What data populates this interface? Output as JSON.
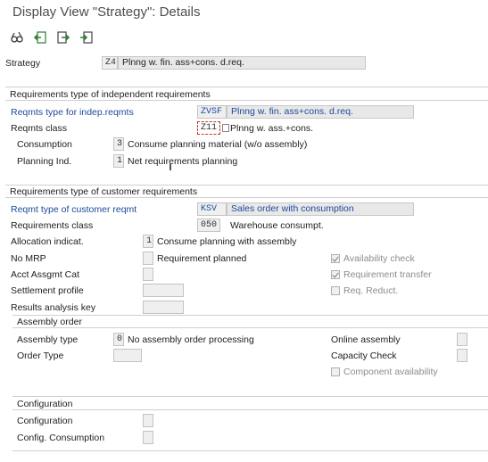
{
  "title": "Display View \"Strategy\": Details",
  "toolbar": [
    {
      "icon": "glasses-icon"
    },
    {
      "icon": "back-arrow-icon"
    },
    {
      "icon": "forward-arrow-icon"
    },
    {
      "icon": "export-icon"
    }
  ],
  "strategy": {
    "label": "Strategy",
    "code": "Z4",
    "desc": "Plnng w. fin. ass+cons. d.req."
  },
  "indep": {
    "title": "Requirements type of independent requirements",
    "reqmts_type": {
      "label": "Reqmts type for indep.reqmts",
      "code": "ZVSF",
      "desc": "Plnng w. fin. ass+cons. d.req."
    },
    "reqmts_class": {
      "label": "Reqmts class",
      "code": "Z11",
      "desc": "Plnng w. ass.+cons."
    },
    "consumption": {
      "label": "Consumption",
      "code": "3",
      "desc": "Consume planning material (w/o assembly)"
    },
    "planning_ind": {
      "label": "Planning Ind.",
      "code": "1",
      "desc": "Net requirements planning"
    }
  },
  "cust": {
    "title": "Requirements type of customer requirements",
    "reqmt_type": {
      "label": "Reqmt type of customer reqmt",
      "code": "KSV",
      "desc": "Sales order with consumption"
    },
    "req_class": {
      "label": "Requirements class",
      "code": "050",
      "desc": "Warehouse consumpt."
    },
    "allocation": {
      "label": "Allocation indicat.",
      "code": "1",
      "desc": "Consume planning with assembly"
    },
    "no_mrp": {
      "label": "No MRP",
      "code": "",
      "desc": "Requirement planned"
    },
    "acct": {
      "label": "Acct Assgmt Cat",
      "code": ""
    },
    "settlement": {
      "label": "Settlement profile",
      "code": ""
    },
    "results": {
      "label": "Results analysis key",
      "code": ""
    },
    "availability": {
      "label": "Availability check",
      "checked": true
    },
    "req_transfer": {
      "label": "Requirement transfer",
      "checked": true
    },
    "req_reduct": {
      "label": "Req. Reduct.",
      "checked": false
    }
  },
  "assembly": {
    "title": "Assembly order",
    "assembly_type": {
      "label": "Assembly type",
      "code": "0",
      "desc": "No assembly order processing"
    },
    "order_type": {
      "label": "Order Type",
      "code": ""
    },
    "online": {
      "label": "Online assembly",
      "code": ""
    },
    "capacity": {
      "label": "Capacity Check",
      "code": ""
    },
    "component": {
      "label": "Component availability",
      "checked": false
    }
  },
  "config": {
    "title": "Configuration",
    "configuration": {
      "label": "Configuration",
      "code": ""
    },
    "config_consumption": {
      "label": "Config. Consumption",
      "code": ""
    }
  }
}
